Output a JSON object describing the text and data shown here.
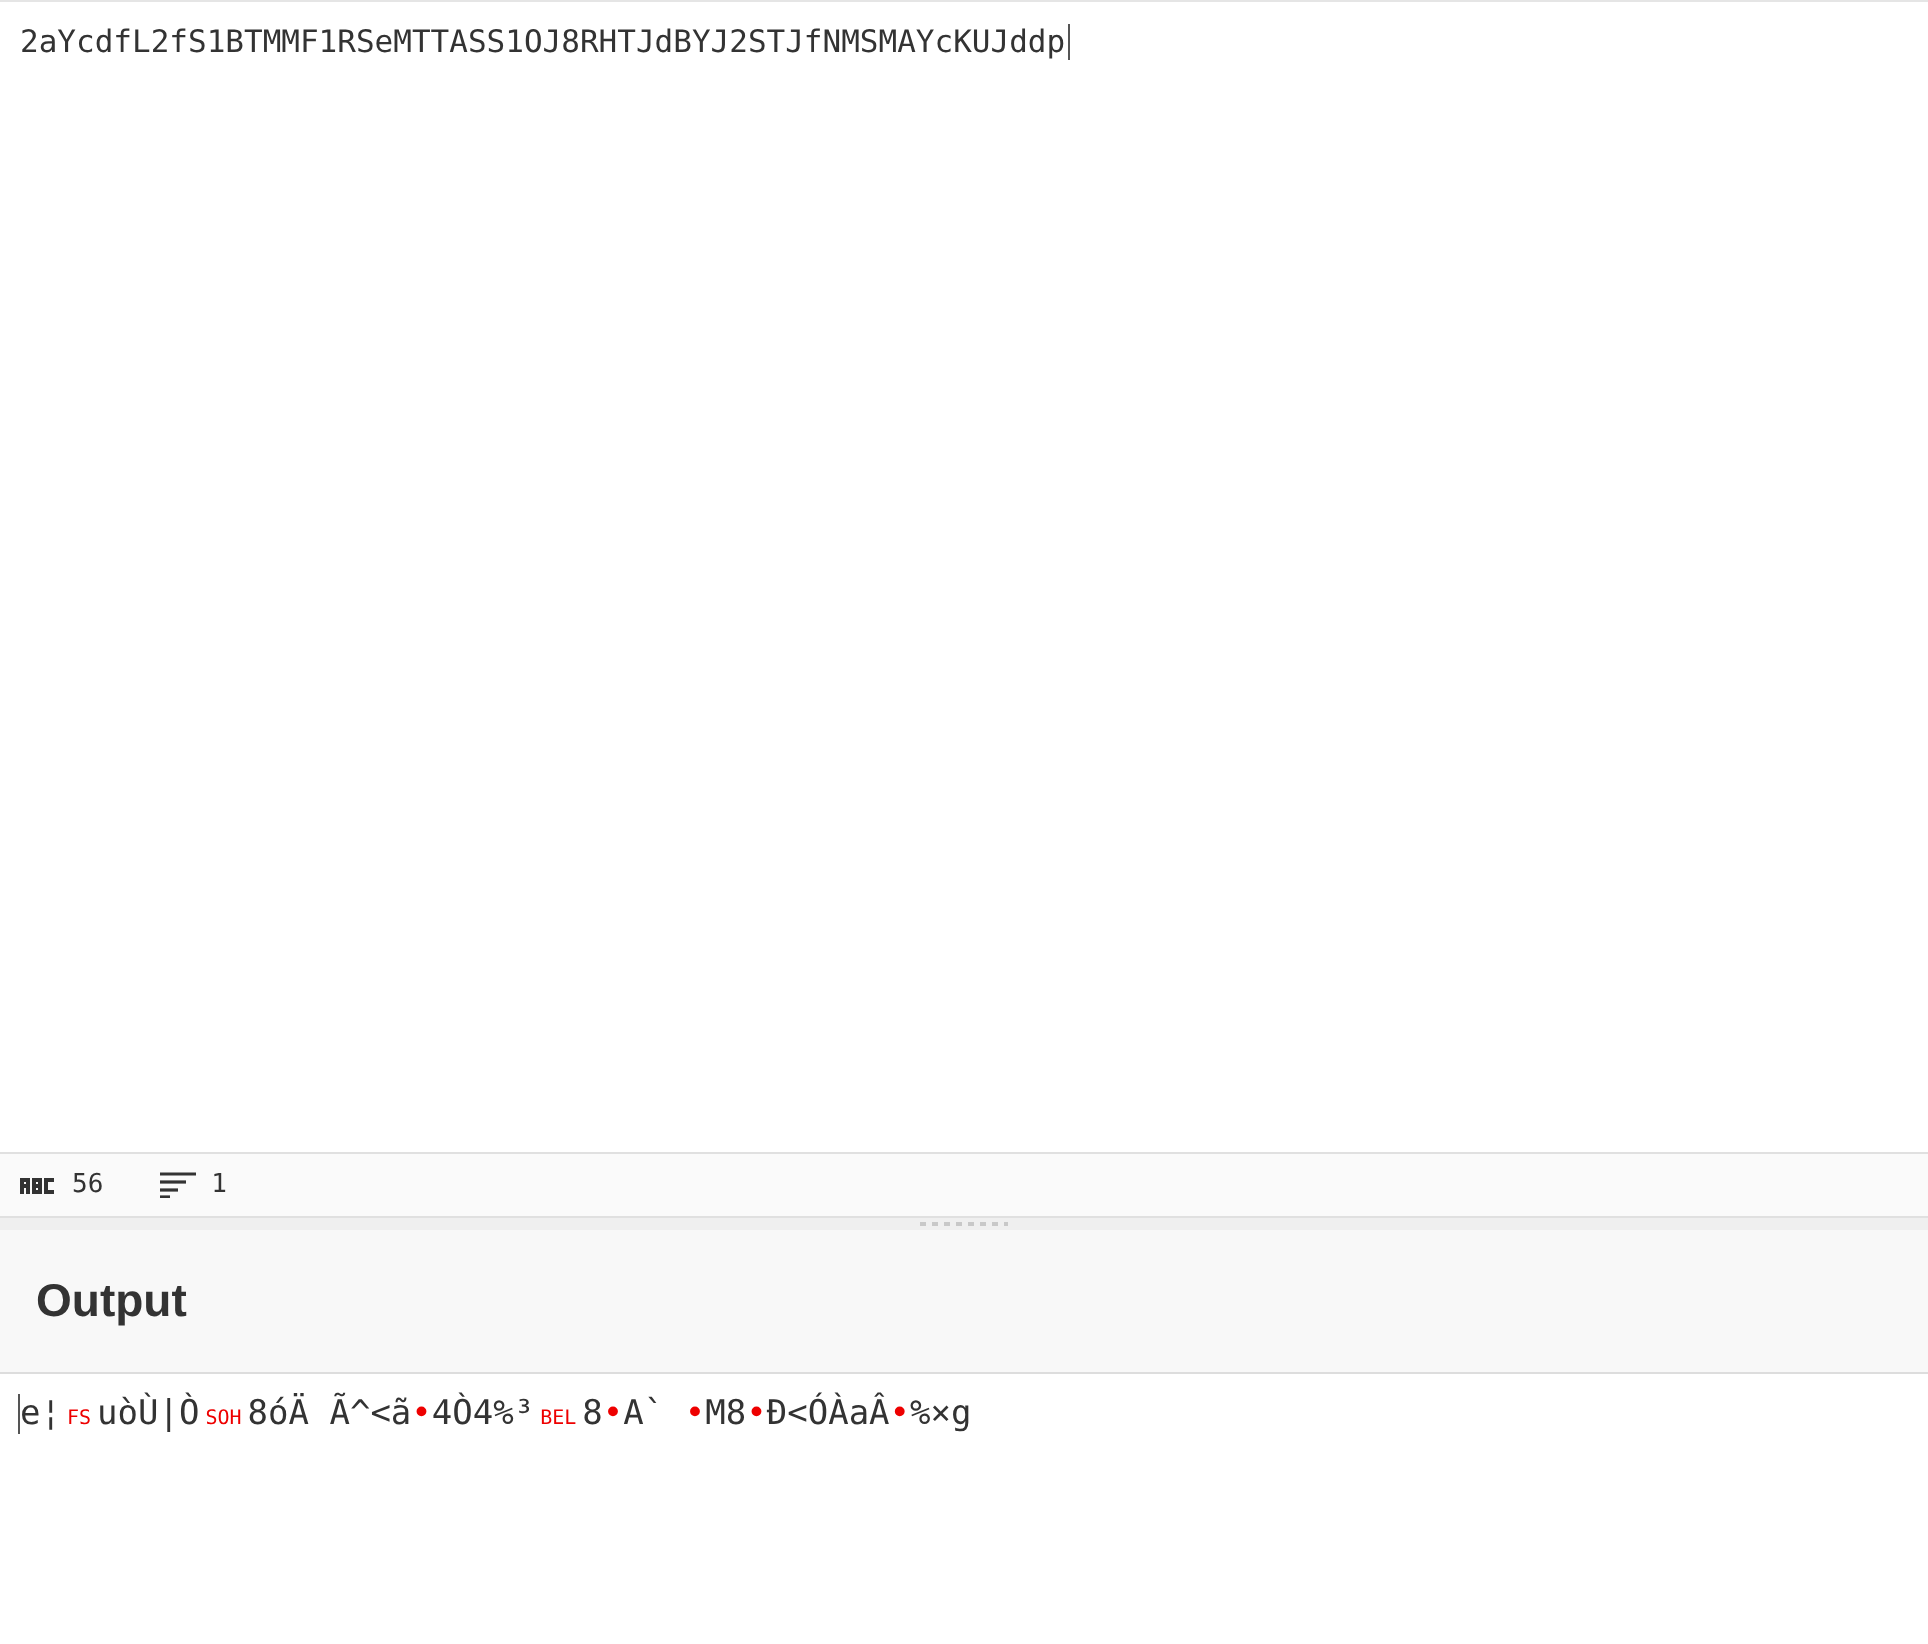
{
  "input": {
    "value": "2aYcdfL2fS1BTMMF1RSeMTTASS1OJ8RHTJdBYJ2STJfNMSMAYcKUJddp"
  },
  "status_bar": {
    "characters": "56",
    "lines": "1"
  },
  "output": {
    "title": "Output",
    "segments": [
      {
        "kind": "text",
        "text": "e¦"
      },
      {
        "kind": "control",
        "text": "FS"
      },
      {
        "kind": "text",
        "text": "uòÙ|Ò"
      },
      {
        "kind": "control",
        "text": "SOH"
      },
      {
        "kind": "text",
        "text": "8óÄ Ã^<ã"
      },
      {
        "kind": "dot",
        "text": "•"
      },
      {
        "kind": "text",
        "text": "4Ò4%³"
      },
      {
        "kind": "control",
        "text": "BEL"
      },
      {
        "kind": "text",
        "text": "8"
      },
      {
        "kind": "dot",
        "text": "•"
      },
      {
        "kind": "text",
        "text": "A` "
      },
      {
        "kind": "dot",
        "text": "•"
      },
      {
        "kind": "text",
        "text": "M8"
      },
      {
        "kind": "dot",
        "text": "•"
      },
      {
        "kind": "text",
        "text": "Ð<ÓÀaÂ"
      },
      {
        "kind": "dot",
        "text": "•"
      },
      {
        "kind": "text",
        "text": "%×g"
      }
    ]
  }
}
